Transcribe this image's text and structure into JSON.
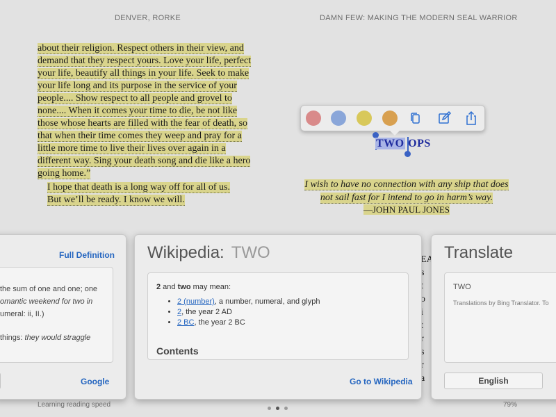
{
  "header": {
    "author": "DENVER, RORKE",
    "book_title": "DAMN FEW: MAKING THE MODERN SEAL WARRIOR"
  },
  "page_text": {
    "para1_lines": [
      "about their religion. Respect others in their view, and",
      "demand that they respect yours. Love your life, perfect",
      "your life, beautify all things in your life. Seek to make",
      "your life long and its purpose in the service of your",
      "people.... Show respect to all people and grovel to",
      "none.... When it comes your time to die, be not like",
      "those whose hearts are filled with the fear of death, so",
      "that when their time comes they weep and pray for a",
      "little more time to live their lives over again in a",
      "different way. Sing your death song and die like a hero",
      "going home.”"
    ],
    "para2": "I hope that death is a long way off for all of us.",
    "para3": "But we’ll be ready. I know we will."
  },
  "selection": {
    "selected": "TWO",
    "rest": " OPS"
  },
  "toolbar": {
    "colors": [
      "#d98a8a",
      "#8aa6d9",
      "#d8c85a",
      "#d8a050"
    ],
    "icons": [
      "copy-icon",
      "note-icon",
      "share-icon"
    ]
  },
  "epigraph": {
    "line1": "I wish to have no connection with any ship that does",
    "line2": "not sail fast for I intend to go in harm’s way.",
    "attribution": "—JOHN PAUL JONES"
  },
  "dictionary_panel": {
    "full_definition": "Full Definition",
    "lines": [
      "the sum of one and one; one",
      "omantic weekend for two in",
      "umeral: ii, II.)"
    ],
    "example_prefix": "things: ",
    "example_italic": "they would straggle",
    "google": "Google"
  },
  "wikipedia_panel": {
    "title_prefix": "Wikipedia:",
    "title_term": "TWO",
    "intro_pre": "2",
    "intro_mid": " and ",
    "intro_bold": "two",
    "intro_post": " may mean:",
    "items": [
      {
        "link": "2 (number)",
        "text": ", a number, numeral, and glyph"
      },
      {
        "link": "2",
        "text": ", the year 2 AD"
      },
      {
        "link": "2 BC",
        "text": ", the year 2 BC"
      }
    ],
    "contents": "Contents",
    "go": "Go to Wikipedia"
  },
  "translate_panel": {
    "title": "Translate",
    "term": "TWO",
    "note": "Translations by Bing Translator. To",
    "language": "English"
  },
  "peek_letters": [
    "EA",
    "s",
    "t",
    "o",
    "i",
    "t",
    "r",
    "s",
    "r",
    "a"
  ],
  "footer": {
    "left": "Learning reading speed",
    "right": "79%"
  },
  "pagination": {
    "count": 3,
    "active": 2
  }
}
